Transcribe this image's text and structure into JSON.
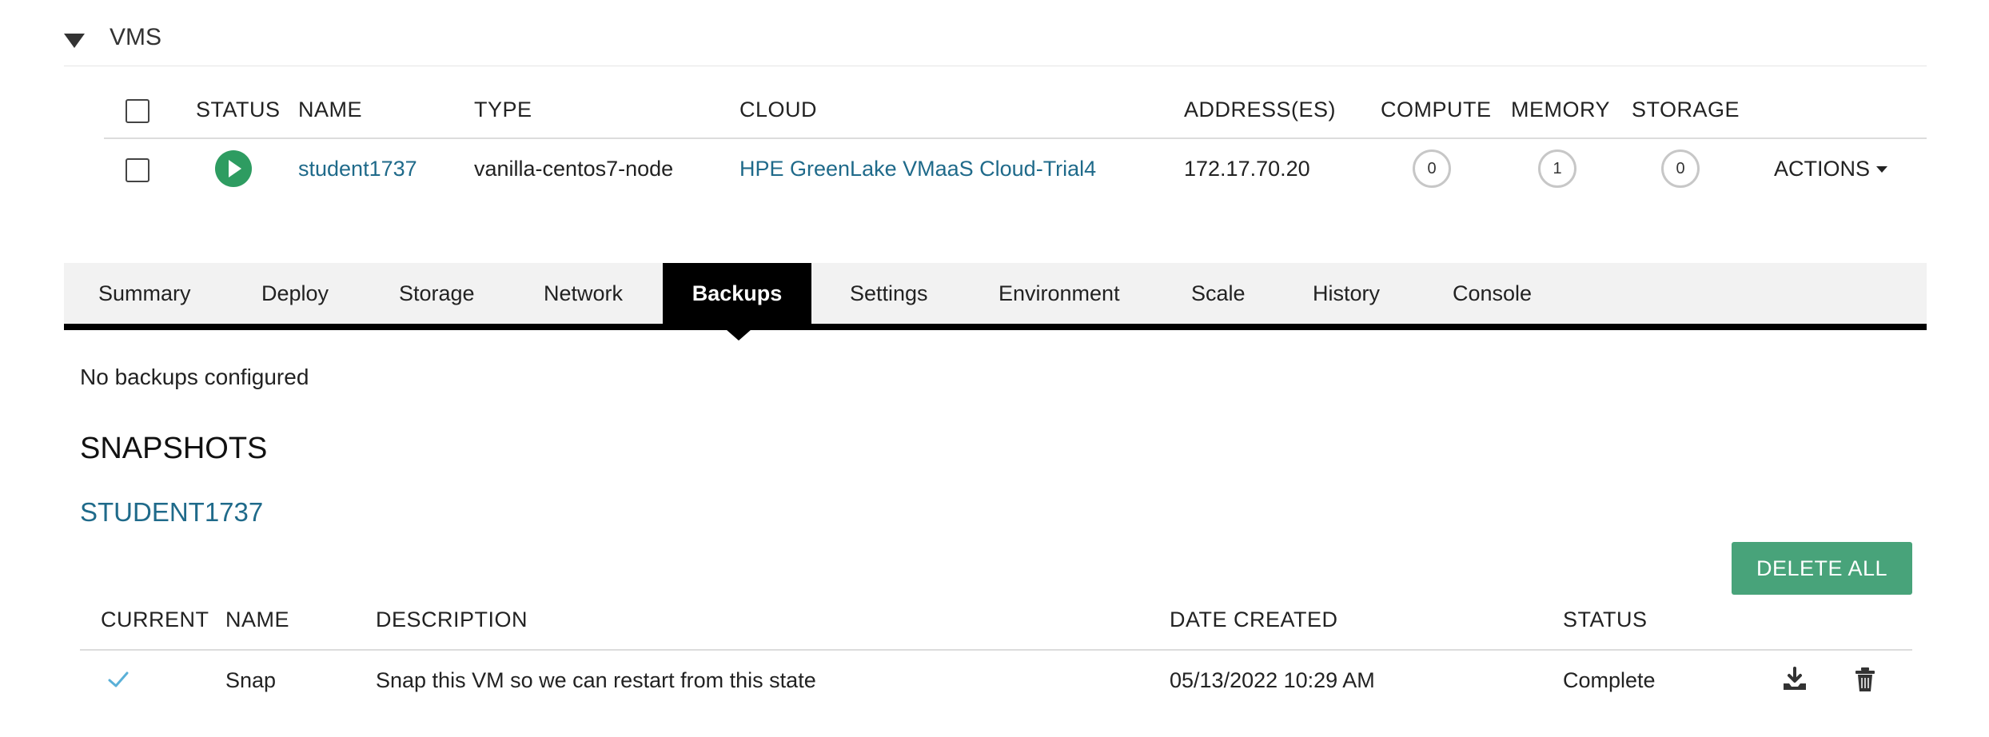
{
  "section": {
    "title": "VMS"
  },
  "vms_table": {
    "columns": {
      "status": "STATUS",
      "name": "NAME",
      "type": "TYPE",
      "cloud": "CLOUD",
      "addresses": "ADDRESS(ES)",
      "compute": "COMPUTE",
      "memory": "MEMORY",
      "storage": "STORAGE"
    },
    "rows": [
      {
        "status": "running",
        "name": "student1737",
        "type": "vanilla-centos7-node",
        "cloud": "HPE GreenLake VMaaS Cloud-Trial4",
        "address": "172.17.70.20",
        "compute": "0",
        "memory": "1",
        "storage": "0",
        "actions": "ACTIONS"
      }
    ]
  },
  "tabs": [
    "Summary",
    "Deploy",
    "Storage",
    "Network",
    "Backups",
    "Settings",
    "Environment",
    "Scale",
    "History",
    "Console"
  ],
  "active_tab": "Backups",
  "backups": {
    "message": "No backups configured"
  },
  "snapshots": {
    "heading": "SNAPSHOTS",
    "vm_name": "STUDENT1737",
    "delete_all_label": "DELETE ALL",
    "columns": {
      "current": "CURRENT",
      "name": "NAME",
      "description": "DESCRIPTION",
      "date_created": "DATE CREATED",
      "status": "STATUS"
    },
    "rows": [
      {
        "current": true,
        "name": "Snap",
        "description": "Snap this VM so we can restart from this state",
        "date_created": "05/13/2022 10:29 AM",
        "status": "Complete"
      }
    ]
  },
  "colors": {
    "link": "#1f6a8a",
    "status_running": "#2e9c61",
    "delete_button": "#48a37a",
    "current_check": "#5ab0d8"
  },
  "icons": {
    "collapse": "caret-down-icon",
    "status": "play-icon",
    "current": "check-icon",
    "restore": "download-icon",
    "delete": "trash-icon"
  }
}
